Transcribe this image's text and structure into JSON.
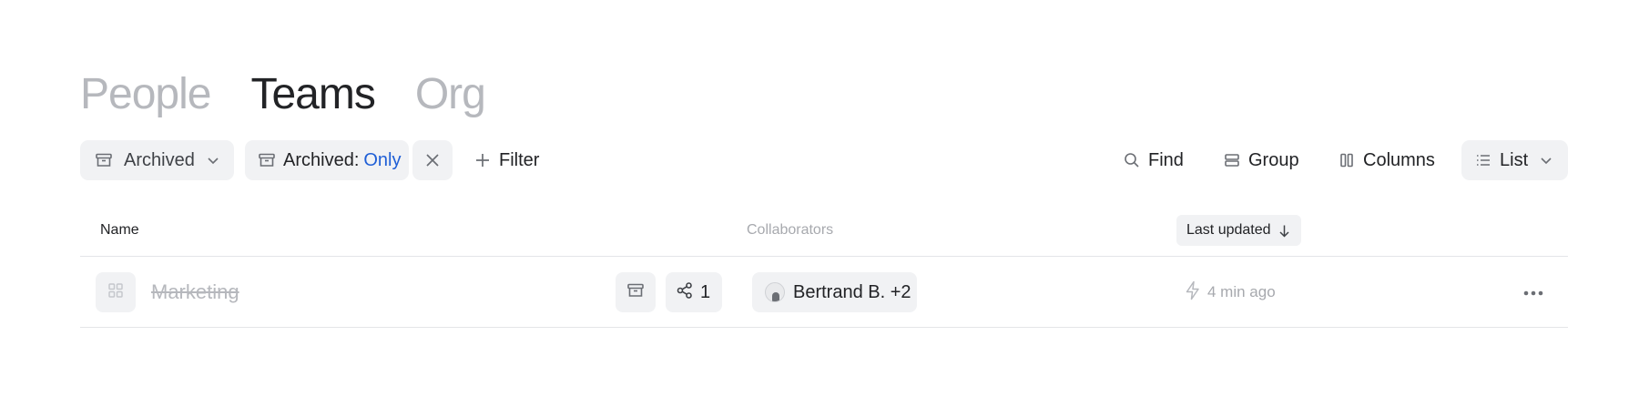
{
  "tabs": [
    {
      "label": "People",
      "active": false
    },
    {
      "label": "Teams",
      "active": true
    },
    {
      "label": "Org",
      "active": false
    }
  ],
  "toolbar": {
    "view_label": "Archived",
    "filter_chip_key": "Archived:",
    "filter_chip_value": "Only",
    "add_filter_label": "Filter",
    "find_label": "Find",
    "group_label": "Group",
    "columns_label": "Columns",
    "layout_label": "List"
  },
  "table": {
    "columns": {
      "name": "Name",
      "collaborators": "Collaborators",
      "last_updated": "Last updated"
    },
    "rows": [
      {
        "name": "Marketing",
        "archived": true,
        "share_count": "1",
        "collaborators": "Bertrand B. +2",
        "updated": "4 min ago"
      }
    ]
  },
  "icons": {
    "archive": "archive-box-icon",
    "chevron": "chevron-down-icon",
    "close": "close-icon",
    "plus": "plus-icon",
    "search": "search-icon",
    "group": "group-icon",
    "columns": "columns-icon",
    "list": "list-icon",
    "sort": "arrow-down-icon",
    "share": "share-icon",
    "bolt": "bolt-icon",
    "more": "more-horizontal-icon"
  },
  "colors": {
    "accent": "#1f5fd6",
    "chip_bg": "#f1f2f4",
    "muted_text": "#b6b8bd"
  }
}
